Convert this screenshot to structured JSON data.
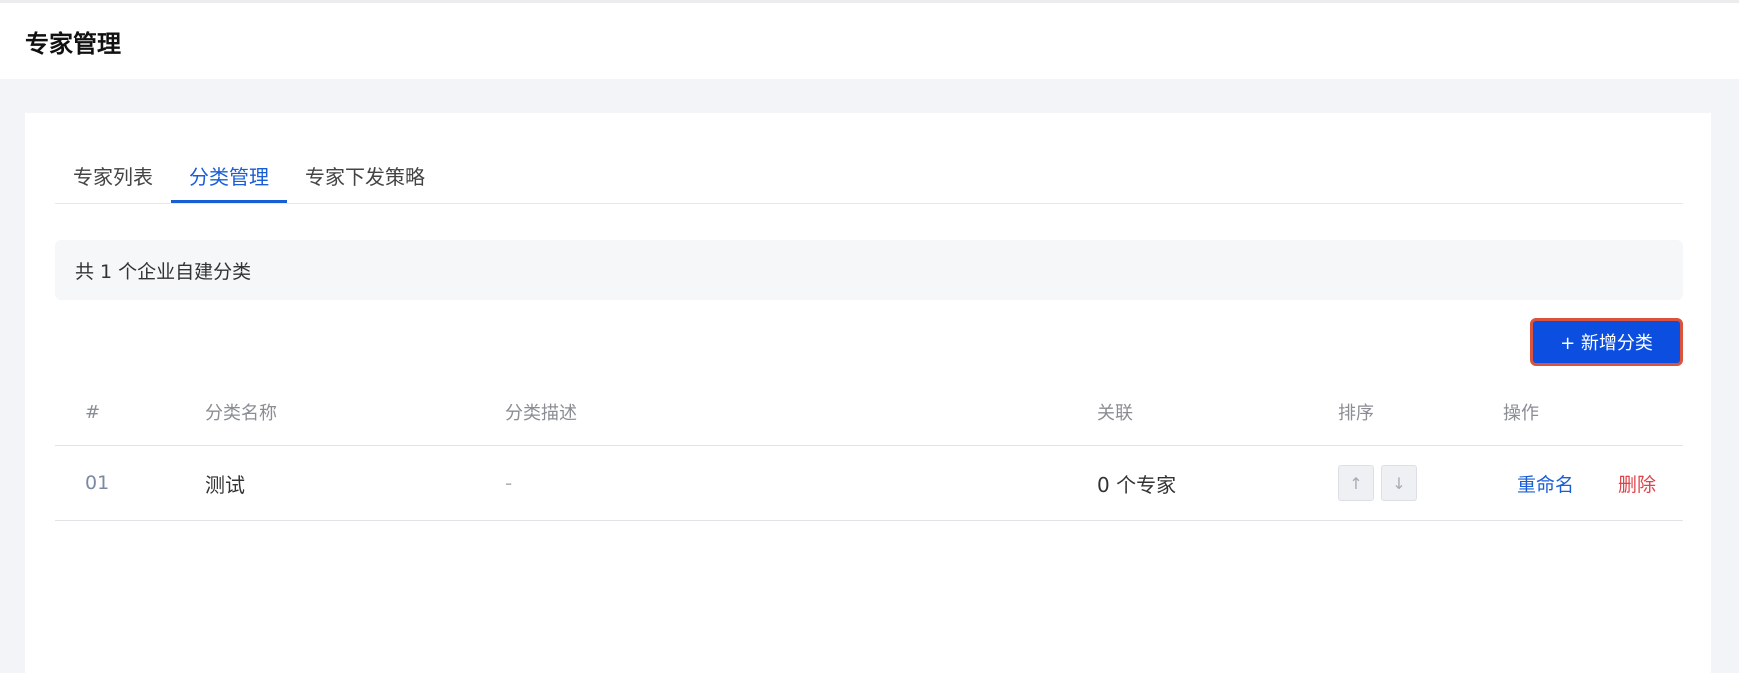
{
  "header": {
    "title": "专家管理"
  },
  "tabs": [
    {
      "label": "专家列表",
      "active": false
    },
    {
      "label": "分类管理",
      "active": true
    },
    {
      "label": "专家下发策略",
      "active": false
    }
  ],
  "summary": {
    "text": "共 1 个企业自建分类"
  },
  "toolbar": {
    "add_label": "+ 新增分类"
  },
  "table": {
    "columns": [
      "#",
      "分类名称",
      "分类描述",
      "关联",
      "排序",
      "操作"
    ],
    "rows": [
      {
        "index": "01",
        "name": "测试",
        "description": "-",
        "relation": "0 个专家",
        "sort_up": "↑",
        "sort_down": "↓",
        "actions": {
          "rename": "重命名",
          "delete": "删除"
        }
      }
    ]
  },
  "colors": {
    "accent": "#1a5ed6",
    "button": "#0b4ee0",
    "danger": "#e0424a",
    "highlight_border": "#d9533d"
  }
}
